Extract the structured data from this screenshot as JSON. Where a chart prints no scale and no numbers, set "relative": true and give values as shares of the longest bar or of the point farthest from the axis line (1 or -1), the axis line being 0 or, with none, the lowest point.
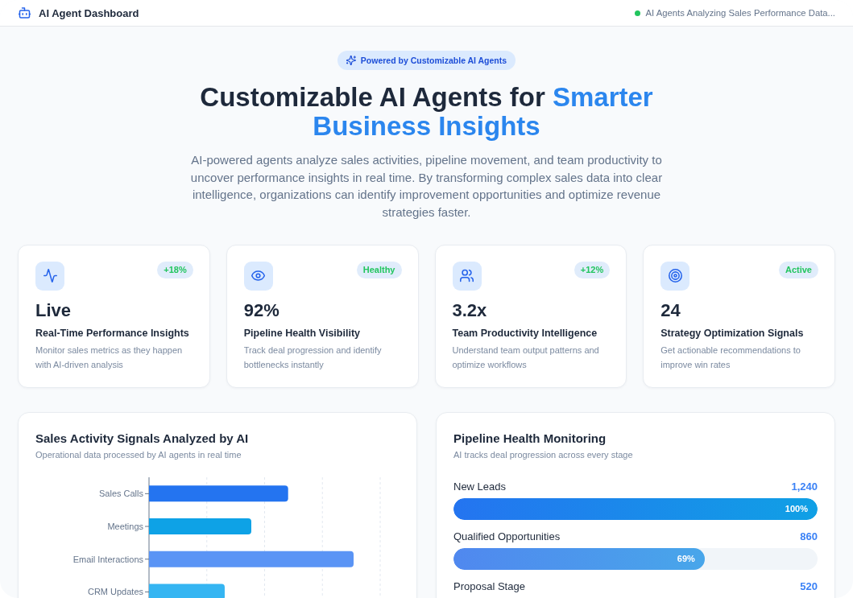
{
  "header": {
    "title": "AI Agent Dashboard",
    "status": {
      "text": "AI Agents Analyzing Sales Performance Data...",
      "active": true
    }
  },
  "hero": {
    "badge": "Powered by Customizable AI Agents",
    "title_lead": "Customizable AI Agents for",
    "title_highlight": "Smarter Business Insights",
    "description": "AI-powered agents analyze sales activities, pipeline movement, and team productivity to uncover performance insights in real time. By transforming complex sales data into clear intelligence, organizations can identify improvement opportunities and optimize revenue strategies faster."
  },
  "metrics": [
    {
      "badge": "+18%",
      "value": "Live",
      "title": "Real-Time Performance Insights",
      "description": "Monitor sales metrics as they happen with AI-driven analysis"
    },
    {
      "badge": "Healthy",
      "value": "92%",
      "title": "Pipeline Health Visibility",
      "description": "Track deal progression and identify bottlenecks instantly"
    },
    {
      "badge": "+12%",
      "value": "3.2x",
      "title": "Team Productivity Intelligence",
      "description": "Understand team output patterns and optimize workflows"
    },
    {
      "badge": "Active",
      "value": "24",
      "title": "Strategy Optimization Signals",
      "description": "Get actionable recommendations to improve win rates"
    }
  ],
  "activity_panel": {
    "title": "Sales Activity Signals Analyzed by AI",
    "subtitle": "Operational data processed by AI agents in real time",
    "chart_data": {
      "type": "bar",
      "orientation": "horizontal",
      "relative": true,
      "categories": [
        "Sales Calls",
        "Meetings",
        "Email Interactions",
        "CRM Updates"
      ],
      "values": [
        0.68,
        0.5,
        1.0,
        0.37
      ],
      "colors": [
        "#2474f0",
        "#0ea2e6",
        "#5a94f5",
        "#35b5f2"
      ]
    }
  },
  "pipeline_panel": {
    "title": "Pipeline Health Monitoring",
    "subtitle": "AI tracks deal progression across every stage",
    "stages": [
      {
        "name": "New Leads",
        "value": "1,240",
        "level": 1.0,
        "percent": "100%"
      },
      {
        "name": "Qualified Opportunities",
        "value": "860",
        "level": 0.69,
        "percent": "69%"
      },
      {
        "name": "Proposal Stage",
        "value": "520"
      }
    ]
  }
}
